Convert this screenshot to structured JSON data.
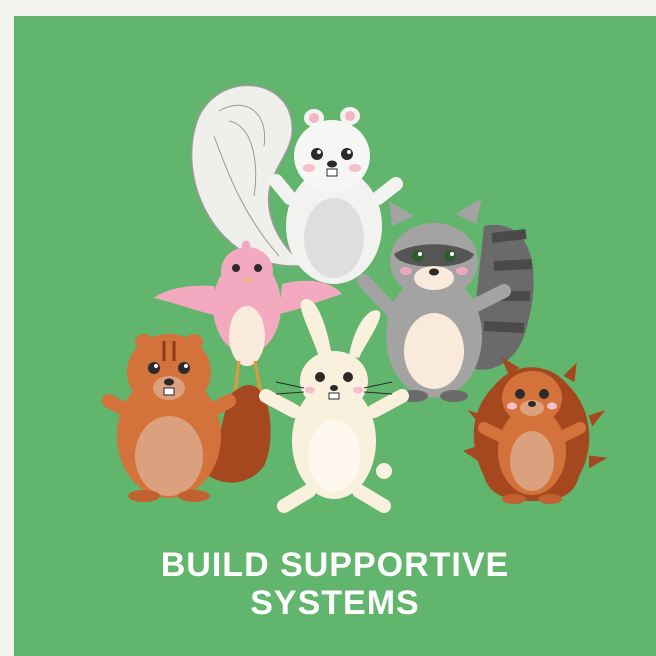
{
  "card": {
    "background_color": "#62b56c",
    "page_background_color": "#f4f4ef",
    "caption_lines": [
      "BUILD SUPPORTIVE",
      "SYSTEMS"
    ],
    "caption_color": "#ffffff"
  },
  "illustration": {
    "characters": [
      "white-squirrel-icon",
      "raccoon-icon",
      "pink-bird-icon",
      "chipmunk-icon",
      "bunny-icon",
      "hedgehog-icon"
    ]
  }
}
